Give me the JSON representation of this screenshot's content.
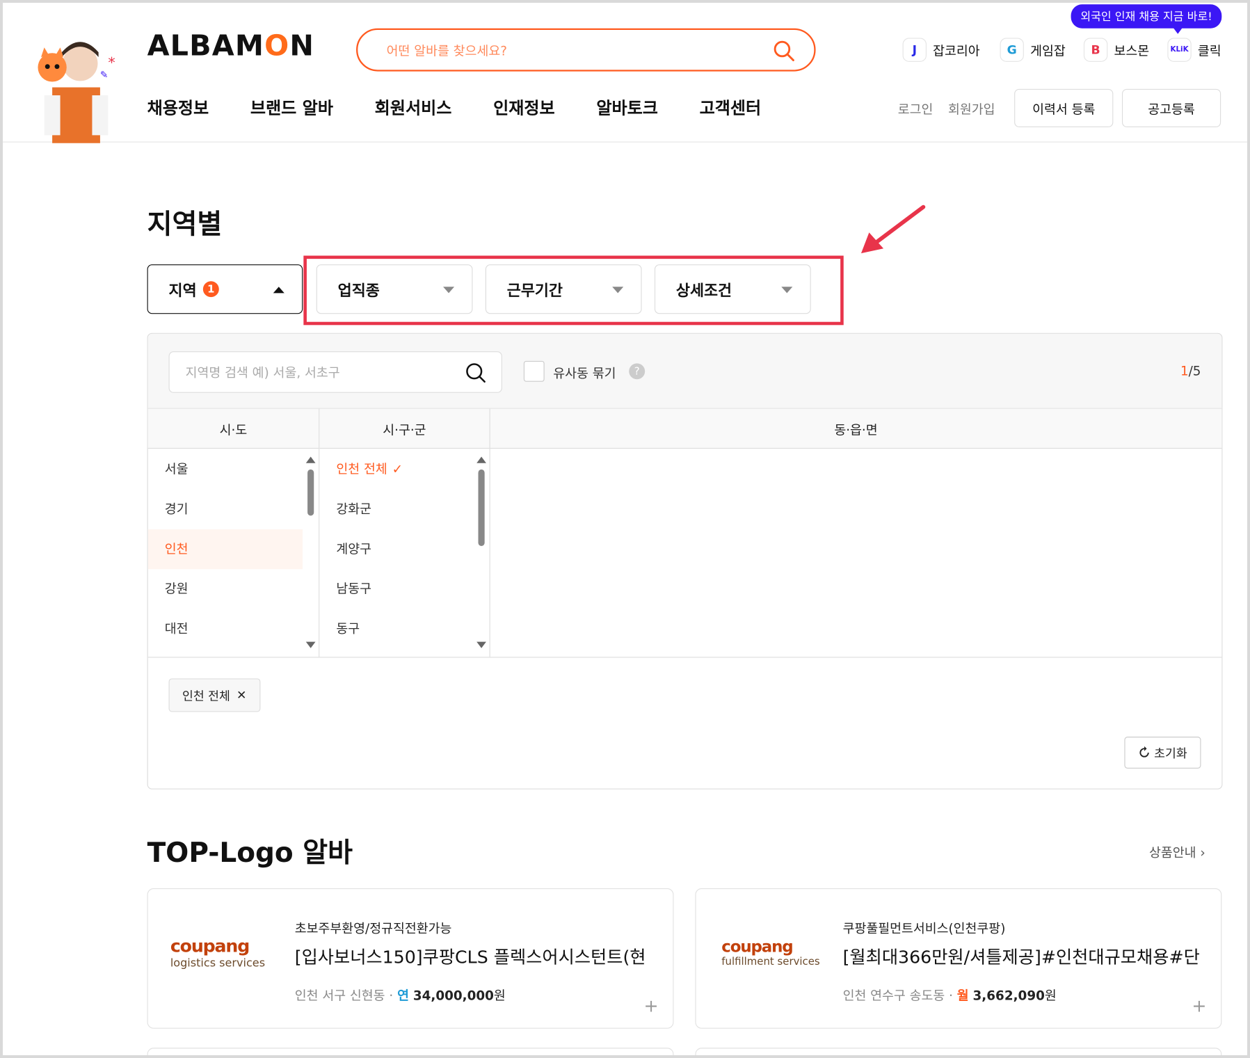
{
  "header": {
    "logo_prefix": "ALBAM",
    "logo_o": "O",
    "logo_suffix": "N",
    "search_placeholder": "어떤 알바를 찾으세요?",
    "bubble": "외국인 인재 채용 지금 바로!",
    "family_sites": [
      {
        "icon_text": "J",
        "label": "잡코리아",
        "color": "#2a2ae8"
      },
      {
        "icon_text": "G",
        "label": "게임잡",
        "color": "#1e9bd6"
      },
      {
        "icon_text": "B",
        "label": "보스몬",
        "color": "#e8344a"
      },
      {
        "icon_text": "KLiK",
        "label": "클릭",
        "color": "#3b17f5"
      }
    ],
    "nav": [
      "채용정보",
      "브랜드 알바",
      "회원서비스",
      "인재정보",
      "알바토크",
      "고객센터"
    ],
    "login": "로그인",
    "signup": "회원가입",
    "resume_button": "이력서 등록",
    "post_button": "공고등록"
  },
  "filters": {
    "title": "지역별",
    "tabs": [
      {
        "label": "지역",
        "count": "1"
      },
      {
        "label": "업직종"
      },
      {
        "label": "근무기간"
      },
      {
        "label": "상세조건"
      }
    ],
    "region_search_placeholder": "지역명 검색 예) 서울, 서초구",
    "similar_dong_label": "유사동 묶기",
    "help": "?",
    "count_current": "1",
    "count_total": "/5",
    "col_headers": [
      "시·도",
      "시·구·군",
      "동·읍·면"
    ],
    "sido": [
      "서울",
      "경기",
      "인천",
      "강원",
      "대전"
    ],
    "sido_selected": "인천",
    "sigungu": [
      "인천 전체",
      "강화군",
      "계양구",
      "남동구",
      "동구"
    ],
    "sigungu_selected": "인천 전체",
    "check_mark": "✓",
    "chip_label": "인천 전체",
    "chip_close": "✕",
    "reset_label": "초기화"
  },
  "top_logo": {
    "title": "TOP-Logo 알바",
    "more_label": "상품안내",
    "cards": [
      {
        "logo_word": "coupang",
        "logo_sub": "logistics services",
        "company": "초보주부환영/정규직전환가능",
        "title": "[입사보너스150]쿠팡CLS 플렉스어시스턴트(현",
        "location": "인천 서구 신현동 · ",
        "pay_type": "연",
        "pay_type_color": "#1e9bd6",
        "amount": "34,000,000",
        "unit": "원"
      },
      {
        "logo_word": "coupang",
        "logo_sub": "fulfillment services",
        "company": "쿠팡풀필먼트서비스(인천쿠팡)",
        "title": "[월최대366만원/셔틀제공]#인천대규모채용#단",
        "location": "인천 연수구 송도동 · ",
        "pay_type": "월",
        "pay_type_color": "#ff5a1f",
        "amount": "3,662,090",
        "unit": "원"
      }
    ]
  },
  "colors": {
    "accent": "#ff5a1f",
    "highlight_box": "#e8344a",
    "bubble": "#3b17f5"
  }
}
